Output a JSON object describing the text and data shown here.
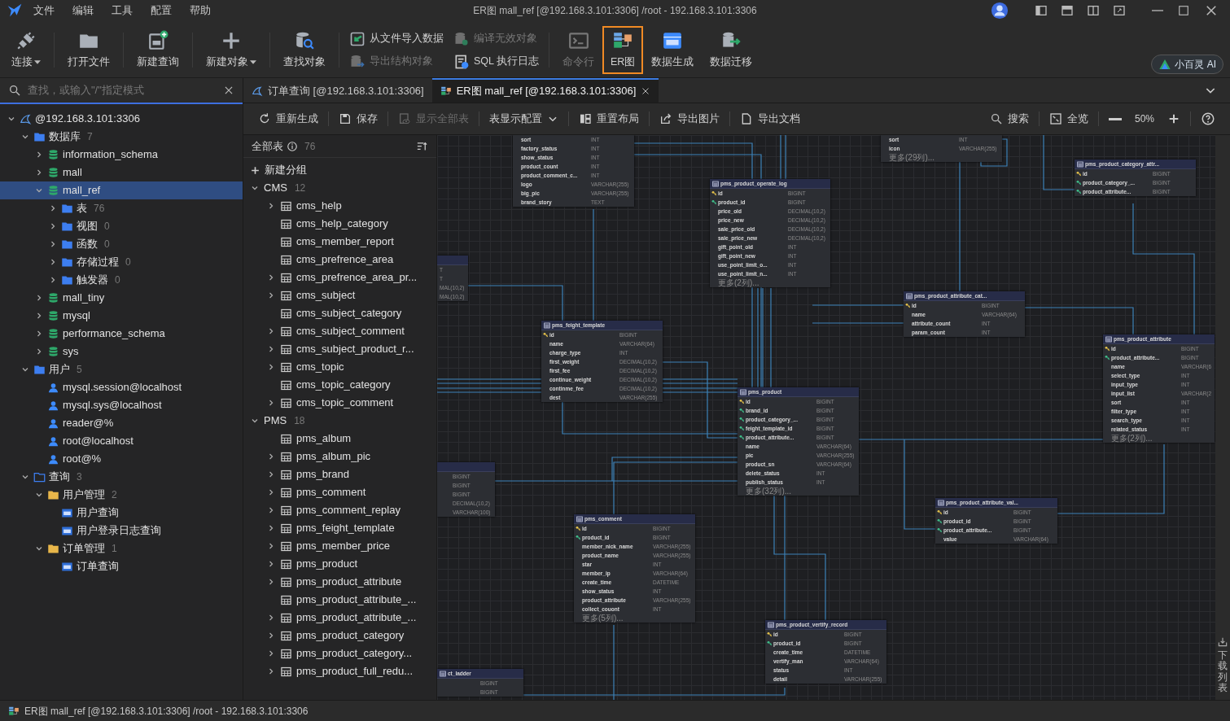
{
  "menu": [
    "文件",
    "编辑",
    "工具",
    "配置",
    "帮助"
  ],
  "window": {
    "title": "ER图 mall_ref [@192.168.3.101:3306] /root  - 192.168.3.101:3306"
  },
  "toolbar": [
    {
      "label": "连接",
      "kind": "large",
      "dropdown": true,
      "disabled": false,
      "selected": false
    },
    {
      "label": "打开文件",
      "kind": "large",
      "disabled": false,
      "selected": false
    },
    {
      "label": "新建查询",
      "kind": "large",
      "disabled": false,
      "selected": false
    },
    {
      "label": "新建对象",
      "kind": "large",
      "dropdown": true,
      "disabled": false,
      "selected": false
    },
    {
      "label": "查找对象",
      "kind": "large",
      "disabled": false,
      "selected": false
    },
    {
      "label": "从文件导入数据",
      "kind": "small",
      "disabled": false
    },
    {
      "label": "导出结构对象",
      "kind": "small",
      "disabled": true
    },
    {
      "label": "编译无效对象",
      "kind": "small",
      "disabled": true
    },
    {
      "label": "SQL 执行日志",
      "kind": "small",
      "disabled": false
    },
    {
      "label": "命令行",
      "kind": "large",
      "disabled": true,
      "selected": false
    },
    {
      "label": "ER图",
      "kind": "large",
      "disabled": false,
      "selected": true
    },
    {
      "label": "数据生成",
      "kind": "large",
      "disabled": false,
      "selected": false
    },
    {
      "label": "数据迁移",
      "kind": "large",
      "disabled": false,
      "selected": false
    }
  ],
  "ai_button": {
    "label": "小百灵 AI"
  },
  "search": {
    "placeholder": "查找，或输入\"/\"指定模式"
  },
  "tree": [
    {
      "label": "@192.168.3.101:3306",
      "kind": "connection",
      "expanded": true,
      "selected": false,
      "children": [
        {
          "label": "数据库",
          "count": "7",
          "kind": "folder",
          "expanded": true,
          "selected": false,
          "children": [
            {
              "label": "information_schema",
              "kind": "database",
              "expanded": false,
              "selected": false
            },
            {
              "label": "mall",
              "kind": "database",
              "expanded": false,
              "selected": false
            },
            {
              "label": "mall_ref",
              "kind": "database",
              "expanded": true,
              "selected": true,
              "children": [
                {
                  "label": "表",
                  "count": "76",
                  "kind": "folder",
                  "expanded": false,
                  "selected": false
                },
                {
                  "label": "视图",
                  "count": "0",
                  "kind": "folder",
                  "expanded": false,
                  "selected": false
                },
                {
                  "label": "函数",
                  "count": "0",
                  "kind": "folder",
                  "expanded": false,
                  "selected": false
                },
                {
                  "label": "存储过程",
                  "count": "0",
                  "kind": "folder",
                  "expanded": false,
                  "selected": false
                },
                {
                  "label": "触发器",
                  "count": "0",
                  "kind": "folder",
                  "expanded": false,
                  "selected": false
                }
              ]
            },
            {
              "label": "mall_tiny",
              "kind": "database",
              "expanded": false,
              "selected": false
            },
            {
              "label": "mysql",
              "kind": "database",
              "expanded": false,
              "selected": false
            },
            {
              "label": "performance_schema",
              "kind": "database",
              "expanded": false,
              "selected": false
            },
            {
              "label": "sys",
              "kind": "database",
              "expanded": false,
              "selected": false
            }
          ]
        },
        {
          "label": "用户",
          "count": "5",
          "kind": "folder",
          "expanded": true,
          "selected": false,
          "children": [
            {
              "label": "mysql.session@localhost",
              "kind": "user",
              "selected": false
            },
            {
              "label": "mysql.sys@localhost",
              "kind": "user",
              "selected": false
            },
            {
              "label": "reader@%",
              "kind": "user",
              "selected": false
            },
            {
              "label": "root@localhost",
              "kind": "user",
              "selected": false
            },
            {
              "label": "root@%",
              "kind": "user",
              "selected": false
            }
          ]
        },
        {
          "label": "查询",
          "count": "3",
          "kind": "query-folder",
          "expanded": true,
          "selected": false,
          "children": [
            {
              "label": "用户管理",
              "count": "2",
              "kind": "group-folder",
              "expanded": true,
              "selected": false,
              "children": [
                {
                  "label": "用户查询",
                  "kind": "query",
                  "selected": false
                },
                {
                  "label": "用户登录日志查询",
                  "kind": "query",
                  "selected": false
                }
              ]
            },
            {
              "label": "订单管理",
              "count": "1",
              "kind": "group-folder",
              "expanded": true,
              "selected": false,
              "children": [
                {
                  "label": "订单查询",
                  "kind": "query",
                  "selected": false
                }
              ]
            }
          ]
        }
      ]
    }
  ],
  "tabs": [
    {
      "label": "订单查询 [@192.168.3.101:3306]",
      "selected": false
    },
    {
      "label": "ER图 mall_ref [@192.168.3.101:3306]",
      "selected": true,
      "closable": true
    }
  ],
  "er_toolbar": {
    "left": [
      {
        "label": "重新生成",
        "disabled": false
      },
      {
        "label": "保存",
        "disabled": false
      },
      {
        "label": "显示全部表",
        "disabled": true
      },
      {
        "label": "表显示配置",
        "disabled": false,
        "dropdown": true
      },
      {
        "label": "重置布局",
        "disabled": false
      },
      {
        "label": "导出图片",
        "disabled": false
      },
      {
        "label": "导出文档",
        "disabled": false
      }
    ],
    "right": [
      {
        "label": "搜索"
      },
      {
        "label": "全览"
      }
    ],
    "zoom": "50%"
  },
  "table_list": {
    "title": "全部表",
    "count": "76",
    "new_group": "新建分组",
    "groups": [
      {
        "name": "CMS",
        "count": "12",
        "expanded": true,
        "items": [
          {
            "name": "cms_help",
            "expanded": false
          },
          {
            "name": "cms_help_category"
          },
          {
            "name": "cms_member_report"
          },
          {
            "name": "cms_prefrence_area"
          },
          {
            "name": "cms_prefrence_area_pr...",
            "expanded": false
          },
          {
            "name": "cms_subject",
            "expanded": false
          },
          {
            "name": "cms_subject_category"
          },
          {
            "name": "cms_subject_comment",
            "expanded": false
          },
          {
            "name": "cms_subject_product_r...",
            "expanded": false
          },
          {
            "name": "cms_topic",
            "expanded": false
          },
          {
            "name": "cms_topic_category"
          },
          {
            "name": "cms_topic_comment",
            "expanded": false
          }
        ]
      },
      {
        "name": "PMS",
        "count": "18",
        "expanded": true,
        "items": [
          {
            "name": "pms_album"
          },
          {
            "name": "pms_album_pic",
            "expanded": false
          },
          {
            "name": "pms_brand",
            "expanded": false
          },
          {
            "name": "pms_comment",
            "expanded": false
          },
          {
            "name": "pms_comment_replay",
            "expanded": false
          },
          {
            "name": "pms_feight_template",
            "expanded": false
          },
          {
            "name": "pms_member_price",
            "expanded": false
          },
          {
            "name": "pms_product",
            "expanded": false
          },
          {
            "name": "pms_product_attribute",
            "expanded": false
          },
          {
            "name": "pms_product_attribute_..."
          },
          {
            "name": "pms_product_attribute_...",
            "expanded": false
          },
          {
            "name": "pms_product_category",
            "expanded": false
          },
          {
            "name": "pms_product_category...",
            "expanded": false
          },
          {
            "name": "pms_product_full_redu...",
            "expanded": false
          }
        ]
      }
    ]
  },
  "diagram": {
    "tables": [
      {
        "header_visible": false,
        "rows": [
          {
            "name": "sort",
            "type": "INT"
          },
          {
            "name": "factory_status",
            "type": "INT"
          },
          {
            "name": "show_status",
            "type": "INT"
          },
          {
            "name": "product_count",
            "type": "INT"
          },
          {
            "name": "product_comment_c...",
            "type": "INT"
          },
          {
            "name": "logo",
            "type": "VARCHAR(255)"
          },
          {
            "name": "big_pic",
            "type": "VARCHAR(255)"
          },
          {
            "name": "brand_story",
            "type": "TEXT"
          }
        ]
      },
      {
        "header_visible": false,
        "rows": [
          {
            "name": "sort",
            "type": "INT"
          },
          {
            "name": "icon",
            "type": "VARCHAR(255)"
          },
          {
            "name": "更多(29列)..."
          }
        ]
      },
      {
        "header_visible": true,
        "title": "pms_product_operate_log",
        "rows": [
          {
            "name": "id",
            "type": "BIGINT",
            "kind": "primary_key"
          },
          {
            "name": "product_id",
            "type": "BIGINT",
            "kind": "foreign_key"
          },
          {
            "name": "price_old",
            "type": "DECIMAL(10,2)"
          },
          {
            "name": "price_new",
            "type": "DECIMAL(10,2)"
          },
          {
            "name": "sale_price_old",
            "type": "DECIMAL(10,2)"
          },
          {
            "name": "sale_price_new",
            "type": "DECIMAL(10,2)"
          },
          {
            "name": "gift_point_old",
            "type": "INT"
          },
          {
            "name": "gift_point_new",
            "type": "INT"
          },
          {
            "name": "use_point_limit_o...",
            "type": "INT"
          },
          {
            "name": "use_point_limit_n...",
            "type": "INT"
          },
          {
            "name": "更多(2列)..."
          }
        ]
      },
      {
        "header_visible": true,
        "title": "pms_product_category_attr...",
        "rows": [
          {
            "name": "id",
            "type": "BIGINT",
            "kind": "primary_key"
          },
          {
            "name": "product_category_...",
            "type": "BIGINT",
            "kind": "foreign_key"
          },
          {
            "name": "product_attribute...",
            "type": "BIGINT",
            "kind": "foreign_key"
          }
        ]
      },
      {
        "header_visible": true,
        "rows": [
          {
            "type": "T"
          },
          {
            "type": "T"
          },
          {
            "type": "MAL(10,2)"
          },
          {
            "type": "MAL(10,2)"
          }
        ]
      },
      {
        "header_visible": true,
        "title": "pms_feight_template",
        "rows": [
          {
            "name": "id",
            "type": "BIGINT",
            "kind": "primary_key"
          },
          {
            "name": "name",
            "type": "VARCHAR(64)"
          },
          {
            "name": "charge_type",
            "type": "INT"
          },
          {
            "name": "first_weight",
            "type": "DECIMAL(10,2)"
          },
          {
            "name": "first_fee",
            "type": "DECIMAL(10,2)"
          },
          {
            "name": "continue_weight",
            "type": "DECIMAL(10,2)"
          },
          {
            "name": "continme_fee",
            "type": "DECIMAL(10,2)"
          },
          {
            "name": "dest",
            "type": "VARCHAR(255)"
          }
        ]
      },
      {
        "header_visible": true,
        "title": "pms_product_attribute_cat...",
        "rows": [
          {
            "name": "id",
            "type": "BIGINT",
            "kind": "primary_key"
          },
          {
            "name": "name",
            "type": "VARCHAR(64)"
          },
          {
            "name": "attribute_count",
            "type": "INT"
          },
          {
            "name": "param_count",
            "type": "INT"
          }
        ]
      },
      {
        "header_visible": true,
        "title": "pms_product_attribute",
        "rows": [
          {
            "name": "id",
            "type": "BIGINT",
            "kind": "primary_key"
          },
          {
            "name": "product_attribute...",
            "type": "BIGINT",
            "kind": "foreign_key"
          },
          {
            "name": "name",
            "type": "VARCHAR(6"
          },
          {
            "name": "select_type",
            "type": "INT"
          },
          {
            "name": "input_type",
            "type": "INT"
          },
          {
            "name": "input_list",
            "type": "VARCHAR(2"
          },
          {
            "name": "sort",
            "type": "INT"
          },
          {
            "name": "filter_type",
            "type": "INT"
          },
          {
            "name": "search_type",
            "type": "INT"
          },
          {
            "name": "related_status",
            "type": "INT"
          },
          {
            "name": "更多(2列)..."
          }
        ]
      },
      {
        "header_visible": true,
        "title": "pms_product",
        "rows": [
          {
            "name": "id",
            "type": "BIGINT",
            "kind": "primary_key"
          },
          {
            "name": "brand_id",
            "type": "BIGINT",
            "kind": "foreign_key"
          },
          {
            "name": "product_category_...",
            "type": "BIGINT",
            "kind": "foreign_key"
          },
          {
            "name": "feight_template_id",
            "type": "BIGINT",
            "kind": "foreign_key"
          },
          {
            "name": "product_attribute...",
            "type": "BIGINT",
            "kind": "foreign_key"
          },
          {
            "name": "name",
            "type": "VARCHAR(64)"
          },
          {
            "name": "pic",
            "type": "VARCHAR(255)"
          },
          {
            "name": "product_sn",
            "type": "VARCHAR(64)"
          },
          {
            "name": "delete_status",
            "type": "INT"
          },
          {
            "name": "publish_status",
            "type": "INT"
          },
          {
            "name": "更多(32列)..."
          }
        ]
      },
      {
        "header_visible": true,
        "rows": [
          {
            "type": "BIGINT"
          },
          {
            "type": "BIGINT"
          },
          {
            "type": "BIGINT"
          },
          {
            "type": "DECIMAL(10,2)"
          },
          {
            "type": "VARCHAR(100)"
          }
        ]
      },
      {
        "header_visible": true,
        "title": "pms_comment",
        "rows": [
          {
            "name": "id",
            "type": "BIGINT",
            "kind": "primary_key"
          },
          {
            "name": "product_id",
            "type": "BIGINT",
            "kind": "foreign_key"
          },
          {
            "name": "member_nick_name",
            "type": "VARCHAR(255)"
          },
          {
            "name": "product_name",
            "type": "VARCHAR(255)"
          },
          {
            "name": "star",
            "type": "INT"
          },
          {
            "name": "member_ip",
            "type": "VARCHAR(64)"
          },
          {
            "name": "create_time",
            "type": "DATETIME"
          },
          {
            "name": "show_status",
            "type": "INT"
          },
          {
            "name": "product_attribute",
            "type": "VARCHAR(255)"
          },
          {
            "name": "collect_couont",
            "type": "INT"
          },
          {
            "name": "更多(5列)..."
          }
        ]
      },
      {
        "header_visible": true,
        "title": "pms_product_attribute_val...",
        "rows": [
          {
            "name": "id",
            "type": "BIGINT",
            "kind": "primary_key"
          },
          {
            "name": "product_id",
            "type": "BIGINT",
            "kind": "foreign_key"
          },
          {
            "name": "product_attribute...",
            "type": "BIGINT",
            "kind": "foreign_key"
          },
          {
            "name": "value",
            "type": "VARCHAR(64)"
          }
        ]
      },
      {
        "header_visible": true,
        "title": "pms_product_vertify_record",
        "rows": [
          {
            "name": "id",
            "type": "BIGINT",
            "kind": "primary_key"
          },
          {
            "name": "product_id",
            "type": "BIGINT",
            "kind": "foreign_key"
          },
          {
            "name": "create_time",
            "type": "DATETIME"
          },
          {
            "name": "vertify_man",
            "type": "VARCHAR(64)"
          },
          {
            "name": "status",
            "type": "INT"
          },
          {
            "name": "detail",
            "type": "VARCHAR(255)"
          }
        ]
      },
      {
        "header_visible": true,
        "title": "ct_ladder",
        "rows": [
          {
            "type": "BIGINT"
          },
          {
            "type": "BIGINT"
          }
        ]
      }
    ]
  },
  "download_list": {
    "label": "下载列表"
  },
  "status_bar": "ER图 mall_ref [@192.168.3.101:3306] /root - 192.168.3.101:3306"
}
